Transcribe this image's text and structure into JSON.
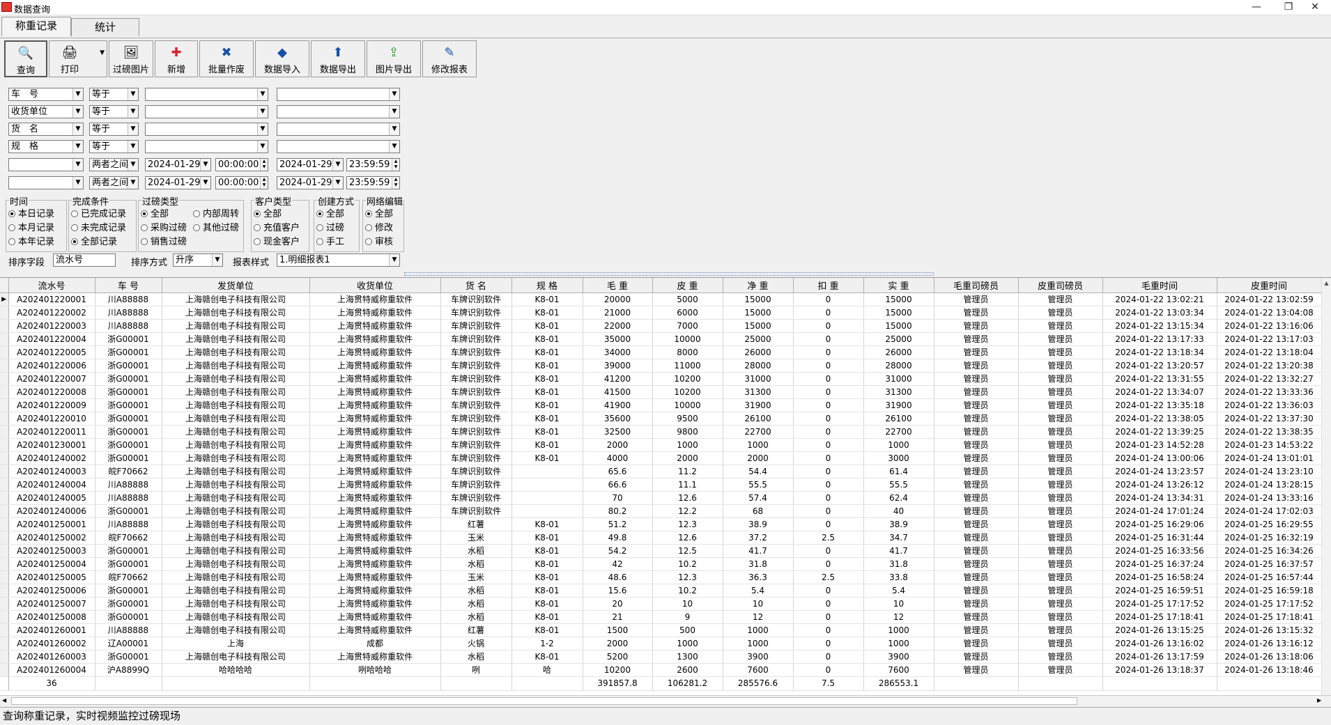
{
  "window": {
    "title": "数据查询",
    "min": "—",
    "restore": "❐",
    "close": "✕"
  },
  "tabs": [
    {
      "label": "称重记录"
    },
    {
      "label": "统计"
    }
  ],
  "toolbar": [
    {
      "label": "查询",
      "icon": "🔍"
    },
    {
      "label": "打印",
      "icon": "🖨"
    },
    {
      "label": "过磅图片",
      "icon": "🖼"
    },
    {
      "label": "新增",
      "icon": "✚"
    },
    {
      "label": "批量作废",
      "icon": "✖"
    },
    {
      "label": "数据导入",
      "icon": "◆"
    },
    {
      "label": "数据导出",
      "icon": "⬆"
    },
    {
      "label": "图片导出",
      "icon": "⇪"
    },
    {
      "label": "修改报表",
      "icon": "✎"
    }
  ],
  "filters": [
    {
      "field": "车　号",
      "op": "等于",
      "v1": "",
      "v2": ""
    },
    {
      "field": "收货单位",
      "op": "等于",
      "v1": "",
      "v2": ""
    },
    {
      "field": "货　名",
      "op": "等于",
      "v1": "",
      "v2": ""
    },
    {
      "field": "规　格",
      "op": "等于",
      "v1": "",
      "v2": ""
    }
  ],
  "date_filters": [
    {
      "field": "",
      "op": "两者之间",
      "date1": "2024-01-29",
      "time1": "00:00:00",
      "date2": "2024-01-29",
      "time2": "23:59:59"
    },
    {
      "field": "",
      "op": "两者之间",
      "date1": "2024-01-29",
      "time1": "00:00:00",
      "date2": "2024-01-29",
      "time2": "23:59:59"
    }
  ],
  "groups": {
    "time": {
      "title": "时间",
      "options": [
        "本日记录",
        "本月记录",
        "本年记录"
      ]
    },
    "complete": {
      "title": "完成条件",
      "options": [
        "已完成记录",
        "未完成记录",
        "全部记录"
      ]
    },
    "weigh": {
      "title": "过磅类型",
      "options": [
        "全部",
        "采购过磅",
        "销售过磅",
        "内部周转",
        "其他过磅"
      ]
    },
    "customer": {
      "title": "客户类型",
      "options": [
        "全部",
        "充值客户",
        "现金客户"
      ]
    },
    "create": {
      "title": "创建方式",
      "options": [
        "全部",
        "过磅",
        "手工"
      ]
    },
    "net": {
      "title": "网络编辑",
      "options": [
        "全部",
        "修改",
        "审核"
      ]
    }
  },
  "sort": {
    "field_label": "排序字段",
    "field_value": "流水号",
    "mode_label": "排序方式",
    "mode_value": "升序",
    "report_label": "报表样式",
    "report_value": "1.明细报表1"
  },
  "table": {
    "headers": [
      "流水号",
      "车 号",
      "发货单位",
      "收货单位",
      "货 名",
      "规 格",
      "毛 重",
      "皮 重",
      "净 重",
      "扣 重",
      "实 重",
      "毛重司磅员",
      "皮重司磅员",
      "毛重时间",
      "皮重时间"
    ],
    "rows": [
      [
        "A202401220001",
        "川A88888",
        "上海赣创电子科技有限公司",
        "上海贯特威称重软件",
        "车牌识别软件",
        "K8-01",
        "20000",
        "5000",
        "15000",
        "0",
        "15000",
        "管理员",
        "管理员",
        "2024-01-22 13:02:21",
        "2024-01-22 13:02:59"
      ],
      [
        "A202401220002",
        "川A88888",
        "上海赣创电子科技有限公司",
        "上海贯特威称重软件",
        "车牌识别软件",
        "K8-01",
        "21000",
        "6000",
        "15000",
        "0",
        "15000",
        "管理员",
        "管理员",
        "2024-01-22 13:03:34",
        "2024-01-22 13:04:08"
      ],
      [
        "A202401220003",
        "川A88888",
        "上海赣创电子科技有限公司",
        "上海贯特威称重软件",
        "车牌识别软件",
        "K8-01",
        "22000",
        "7000",
        "15000",
        "0",
        "15000",
        "管理员",
        "管理员",
        "2024-01-22 13:15:34",
        "2024-01-22 13:16:06"
      ],
      [
        "A202401220004",
        "浙G00001",
        "上海赣创电子科技有限公司",
        "上海贯特威称重软件",
        "车牌识别软件",
        "K8-01",
        "35000",
        "10000",
        "25000",
        "0",
        "25000",
        "管理员",
        "管理员",
        "2024-01-22 13:17:33",
        "2024-01-22 13:17:03"
      ],
      [
        "A202401220005",
        "浙G00001",
        "上海赣创电子科技有限公司",
        "上海贯特威称重软件",
        "车牌识别软件",
        "K8-01",
        "34000",
        "8000",
        "26000",
        "0",
        "26000",
        "管理员",
        "管理员",
        "2024-01-22 13:18:34",
        "2024-01-22 13:18:04"
      ],
      [
        "A202401220006",
        "浙G00001",
        "上海赣创电子科技有限公司",
        "上海贯特威称重软件",
        "车牌识别软件",
        "K8-01",
        "39000",
        "11000",
        "28000",
        "0",
        "28000",
        "管理员",
        "管理员",
        "2024-01-22 13:20:57",
        "2024-01-22 13:20:38"
      ],
      [
        "A202401220007",
        "浙G00001",
        "上海赣创电子科技有限公司",
        "上海贯特威称重软件",
        "车牌识别软件",
        "K8-01",
        "41200",
        "10200",
        "31000",
        "0",
        "31000",
        "管理员",
        "管理员",
        "2024-01-22 13:31:55",
        "2024-01-22 13:32:27"
      ],
      [
        "A202401220008",
        "浙G00001",
        "上海赣创电子科技有限公司",
        "上海贯特威称重软件",
        "车牌识别软件",
        "K8-01",
        "41500",
        "10200",
        "31300",
        "0",
        "31300",
        "管理员",
        "管理员",
        "2024-01-22 13:34:07",
        "2024-01-22 13:33:36"
      ],
      [
        "A202401220009",
        "浙G00001",
        "上海赣创电子科技有限公司",
        "上海贯特威称重软件",
        "车牌识别软件",
        "K8-01",
        "41900",
        "10000",
        "31900",
        "0",
        "31900",
        "管理员",
        "管理员",
        "2024-01-22 13:35:18",
        "2024-01-22 13:36:03"
      ],
      [
        "A202401220010",
        "浙G00001",
        "上海赣创电子科技有限公司",
        "上海贯特威称重软件",
        "车牌识别软件",
        "K8-01",
        "35600",
        "9500",
        "26100",
        "0",
        "26100",
        "管理员",
        "管理员",
        "2024-01-22 13:38:05",
        "2024-01-22 13:37:30"
      ],
      [
        "A202401220011",
        "浙G00001",
        "上海赣创电子科技有限公司",
        "上海贯特威称重软件",
        "车牌识别软件",
        "K8-01",
        "32500",
        "9800",
        "22700",
        "0",
        "22700",
        "管理员",
        "管理员",
        "2024-01-22 13:39:25",
        "2024-01-22 13:38:35"
      ],
      [
        "A202401230001",
        "浙G00001",
        "上海赣创电子科技有限公司",
        "上海贯特威称重软件",
        "车牌识别软件",
        "K8-01",
        "2000",
        "1000",
        "1000",
        "0",
        "1000",
        "管理员",
        "管理员",
        "2024-01-23 14:52:28",
        "2024-01-23 14:53:22"
      ],
      [
        "A202401240002",
        "浙G00001",
        "上海赣创电子科技有限公司",
        "上海贯特威称重软件",
        "车牌识别软件",
        "K8-01",
        "4000",
        "2000",
        "2000",
        "0",
        "3000",
        "管理员",
        "管理员",
        "2024-01-24 13:00:06",
        "2024-01-24 13:01:01"
      ],
      [
        "A202401240003",
        "皖F70662",
        "上海赣创电子科技有限公司",
        "上海贯特威称重软件",
        "车牌识别软件",
        "",
        "65.6",
        "11.2",
        "54.4",
        "0",
        "61.4",
        "管理员",
        "管理员",
        "2024-01-24 13:23:57",
        "2024-01-24 13:23:10"
      ],
      [
        "A202401240004",
        "川A88888",
        "上海赣创电子科技有限公司",
        "上海贯特威称重软件",
        "车牌识别软件",
        "",
        "66.6",
        "11.1",
        "55.5",
        "0",
        "55.5",
        "管理员",
        "管理员",
        "2024-01-24 13:26:12",
        "2024-01-24 13:28:15"
      ],
      [
        "A202401240005",
        "川A88888",
        "上海赣创电子科技有限公司",
        "上海贯特威称重软件",
        "车牌识别软件",
        "",
        "70",
        "12.6",
        "57.4",
        "0",
        "62.4",
        "管理员",
        "管理员",
        "2024-01-24 13:34:31",
        "2024-01-24 13:33:16"
      ],
      [
        "A202401240006",
        "浙G00001",
        "上海赣创电子科技有限公司",
        "上海贯特威称重软件",
        "车牌识别软件",
        "",
        "80.2",
        "12.2",
        "68",
        "0",
        "40",
        "管理员",
        "管理员",
        "2024-01-24 17:01:24",
        "2024-01-24 17:02:03"
      ],
      [
        "A202401250001",
        "川A88888",
        "上海赣创电子科技有限公司",
        "上海贯特威称重软件",
        "红薯",
        "K8-01",
        "51.2",
        "12.3",
        "38.9",
        "0",
        "38.9",
        "管理员",
        "管理员",
        "2024-01-25 16:29:06",
        "2024-01-25 16:29:55"
      ],
      [
        "A202401250002",
        "皖F70662",
        "上海赣创电子科技有限公司",
        "上海贯特威称重软件",
        "玉米",
        "K8-01",
        "49.8",
        "12.6",
        "37.2",
        "2.5",
        "34.7",
        "管理员",
        "管理员",
        "2024-01-25 16:31:44",
        "2024-01-25 16:32:19"
      ],
      [
        "A202401250003",
        "浙G00001",
        "上海赣创电子科技有限公司",
        "上海贯特威称重软件",
        "水稻",
        "K8-01",
        "54.2",
        "12.5",
        "41.7",
        "0",
        "41.7",
        "管理员",
        "管理员",
        "2024-01-25 16:33:56",
        "2024-01-25 16:34:26"
      ],
      [
        "A202401250004",
        "浙G00001",
        "上海赣创电子科技有限公司",
        "上海贯特威称重软件",
        "水稻",
        "K8-01",
        "42",
        "10.2",
        "31.8",
        "0",
        "31.8",
        "管理员",
        "管理员",
        "2024-01-25 16:37:24",
        "2024-01-25 16:37:57"
      ],
      [
        "A202401250005",
        "皖F70662",
        "上海赣创电子科技有限公司",
        "上海贯特威称重软件",
        "玉米",
        "K8-01",
        "48.6",
        "12.3",
        "36.3",
        "2.5",
        "33.8",
        "管理员",
        "管理员",
        "2024-01-25 16:58:24",
        "2024-01-25 16:57:44"
      ],
      [
        "A202401250006",
        "浙G00001",
        "上海赣创电子科技有限公司",
        "上海贯特威称重软件",
        "水稻",
        "K8-01",
        "15.6",
        "10.2",
        "5.4",
        "0",
        "5.4",
        "管理员",
        "管理员",
        "2024-01-25 16:59:51",
        "2024-01-25 16:59:18"
      ],
      [
        "A202401250007",
        "浙G00001",
        "上海赣创电子科技有限公司",
        "上海贯特威称重软件",
        "水稻",
        "K8-01",
        "20",
        "10",
        "10",
        "0",
        "10",
        "管理员",
        "管理员",
        "2024-01-25 17:17:52",
        "2024-01-25 17:17:52"
      ],
      [
        "A202401250008",
        "浙G00001",
        "上海赣创电子科技有限公司",
        "上海贯特威称重软件",
        "水稻",
        "K8-01",
        "21",
        "9",
        "12",
        "0",
        "12",
        "管理员",
        "管理员",
        "2024-01-25 17:18:41",
        "2024-01-25 17:18:41"
      ],
      [
        "A202401260001",
        "川A88888",
        "上海赣创电子科技有限公司",
        "上海贯特威称重软件",
        "红薯",
        "K8-01",
        "1500",
        "500",
        "1000",
        "0",
        "1000",
        "管理员",
        "管理员",
        "2024-01-26 13:15:25",
        "2024-01-26 13:15:32"
      ],
      [
        "A202401260002",
        "辽A00001",
        "上海",
        "成都",
        "火锅",
        "1-2",
        "2000",
        "1000",
        "1000",
        "0",
        "1000",
        "管理员",
        "管理员",
        "2024-01-26 13:16:02",
        "2024-01-26 13:16:12"
      ],
      [
        "A202401260003",
        "浙G00001",
        "上海赣创电子科技有限公司",
        "上海贯特威称重软件",
        "水稻",
        "K8-01",
        "5200",
        "1300",
        "3900",
        "0",
        "3900",
        "管理员",
        "管理员",
        "2024-01-26 13:17:59",
        "2024-01-26 13:18:06"
      ],
      [
        "A202401260004",
        "沪A8899Q",
        "哈哈哈哈",
        "咧哈哈哈",
        "咧",
        "哈",
        "10200",
        "2600",
        "7600",
        "0",
        "7600",
        "管理员",
        "管理员",
        "2024-01-26 13:18:37",
        "2024-01-26 13:18:46"
      ]
    ],
    "summary": [
      "36",
      "",
      "",
      "",
      "",
      "",
      "391857.8",
      "106281.2",
      "285576.6",
      "7.5",
      "286553.1",
      "",
      "",
      "",
      ""
    ]
  },
  "status": "查询称重记录，实时视频监控过磅现场"
}
